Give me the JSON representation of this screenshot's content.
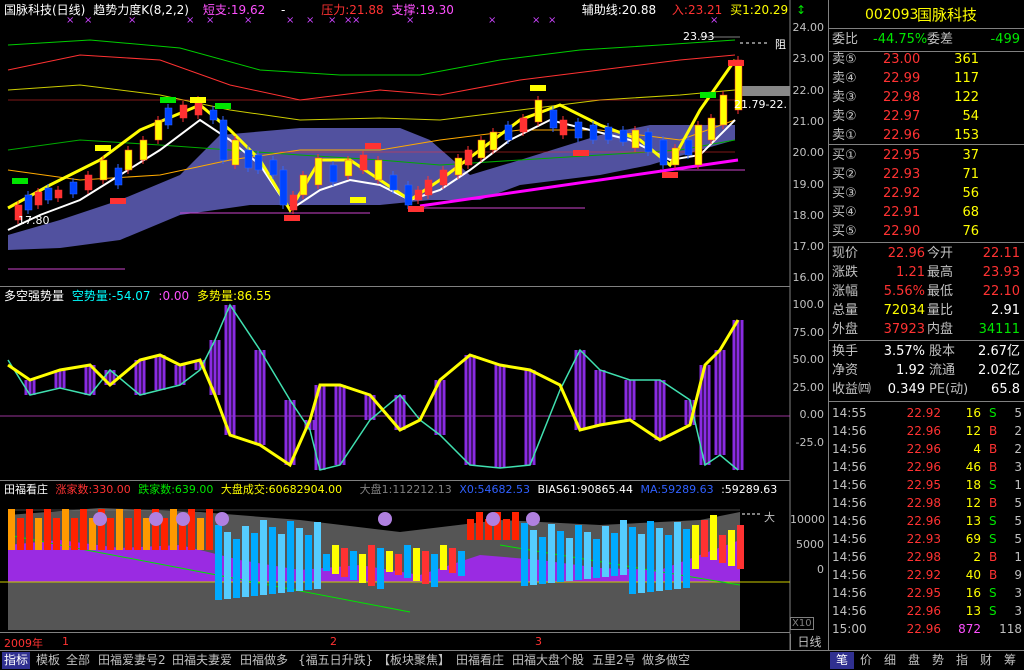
{
  "main_header": {
    "name": "国脉科技(日线)",
    "indicator": "趋势力度K(8,2,2)",
    "short_support": "短支:19.62",
    "dash": "-",
    "pressure": "压力:21.88",
    "support": "支撑:19.30",
    "aux_line": "辅助线:20.88",
    "entry": "入:23.21",
    "buy1": "买1:20.29",
    "arrow": "↕"
  },
  "main_annotations": {
    "peak": "23.93",
    "right_tag": "阻",
    "right_value": "21.79-22.",
    "left_value": "17.80"
  },
  "main_axis": [
    "24.00",
    "23.00",
    "22.00",
    "21.00",
    "20.00",
    "19.00",
    "18.00",
    "17.00",
    "16.00"
  ],
  "mid_header": {
    "title": "多空强势量",
    "empty": "空势量:-54.07",
    "zero": ":0.00",
    "long": "多势量:86.55"
  },
  "mid_axis": [
    "100.0",
    "75.00",
    "50.00",
    "25.00",
    "0.00",
    "-25.0"
  ],
  "low_header": {
    "title": "田福看庄",
    "up_count": "涨家数:330.00",
    "down_count": "跌家数:639.00",
    "market_vol": "大盘成交:60682904.00",
    "market1": "大盘1:112212.13",
    "x": "X0:54682.53",
    "bias": "BIAS61:90865.44",
    "ma": "MA:59289.63",
    "last": ":59289.63"
  },
  "low_axis": [
    "10000",
    "5000",
    "0"
  ],
  "low_annotation": "大",
  "date_bar": {
    "year": "2009年",
    "m1": "1",
    "m2": "2",
    "m3": "3",
    "scale": "X10"
  },
  "stock": {
    "code": "002093",
    "name": "国脉科技"
  },
  "order_book": {
    "webi_label": "委比",
    "webi": "-44.75%",
    "weicha_label": "委差",
    "weicha": "-499",
    "sells": [
      {
        "label": "卖⑤",
        "price": "23.00",
        "vol": "361"
      },
      {
        "label": "卖④",
        "price": "22.99",
        "vol": "117"
      },
      {
        "label": "卖③",
        "price": "22.98",
        "vol": "122"
      },
      {
        "label": "卖②",
        "price": "22.97",
        "vol": "54"
      },
      {
        "label": "卖①",
        "price": "22.96",
        "vol": "153"
      }
    ],
    "buys": [
      {
        "label": "买①",
        "price": "22.95",
        "vol": "37"
      },
      {
        "label": "买②",
        "price": "22.93",
        "vol": "71"
      },
      {
        "label": "买③",
        "price": "22.92",
        "vol": "56"
      },
      {
        "label": "买④",
        "price": "22.91",
        "vol": "68"
      },
      {
        "label": "买⑤",
        "price": "22.90",
        "vol": "76"
      }
    ]
  },
  "quote": [
    {
      "l1": "现价",
      "v1": "22.96",
      "c1": "red",
      "l2": "今开",
      "v2": "22.11",
      "c2": "red"
    },
    {
      "l1": "涨跌",
      "v1": "1.21",
      "c1": "red",
      "l2": "最高",
      "v2": "23.93",
      "c2": "red"
    },
    {
      "l1": "涨幅",
      "v1": "5.56%",
      "c1": "red",
      "l2": "最低",
      "v2": "22.10",
      "c2": "red"
    },
    {
      "l1": "总量",
      "v1": "72034",
      "c1": "yellow",
      "l2": "量比",
      "v2": "2.91",
      "c2": "white"
    },
    {
      "l1": "外盘",
      "v1": "37923",
      "c1": "red",
      "l2": "内盘",
      "v2": "34111",
      "c2": "green"
    }
  ],
  "fundamentals": [
    {
      "l1": "换手",
      "v1": "3.57%",
      "l2": "股本",
      "v2": "2.67亿"
    },
    {
      "l1": "净资",
      "v1": "1.92",
      "l2": "流通",
      "v2": "2.02亿"
    },
    {
      "l1": "收益㈣",
      "v1": "0.349",
      "l2": "PE(动)",
      "v2": "65.8"
    }
  ],
  "ticks": [
    {
      "t": "14:55",
      "p": "22.92",
      "q": "16",
      "f": "S",
      "n": "5"
    },
    {
      "t": "14:56",
      "p": "22.96",
      "q": "12",
      "f": "B",
      "n": "2"
    },
    {
      "t": "14:56",
      "p": "22.96",
      "q": "4",
      "f": "B",
      "n": "2"
    },
    {
      "t": "14:56",
      "p": "22.96",
      "q": "46",
      "f": "B",
      "n": "3"
    },
    {
      "t": "14:56",
      "p": "22.95",
      "q": "18",
      "f": "S",
      "n": "1"
    },
    {
      "t": "14:56",
      "p": "22.98",
      "q": "12",
      "f": "B",
      "n": "5"
    },
    {
      "t": "14:56",
      "p": "22.96",
      "q": "13",
      "f": "S",
      "n": "5"
    },
    {
      "t": "14:56",
      "p": "22.93",
      "q": "69",
      "f": "S",
      "n": "5"
    },
    {
      "t": "14:56",
      "p": "22.98",
      "q": "2",
      "f": "B",
      "n": "1"
    },
    {
      "t": "14:56",
      "p": "22.92",
      "q": "40",
      "f": "B",
      "n": "9"
    },
    {
      "t": "14:56",
      "p": "22.95",
      "q": "16",
      "f": "S",
      "n": "3"
    },
    {
      "t": "14:56",
      "p": "22.96",
      "q": "13",
      "f": "S",
      "n": "3"
    },
    {
      "t": "15:00",
      "p": "22.96",
      "q": "872",
      "f": "",
      "n": "118"
    }
  ],
  "tabs": [
    "指标",
    "模板",
    "全部",
    "田福爱妻号2",
    "田福夫妻爱",
    "田福做多",
    "{福五日升跌}",
    "【板块聚焦】",
    "田福看庄",
    "田福大盘个股",
    "五里2号",
    "做多做空"
  ],
  "right_tabs": [
    "笔",
    "价",
    "细",
    "盘",
    "势",
    "指",
    "财",
    "筹"
  ],
  "period": "日线",
  "colors": {
    "up": "#ff3232",
    "down": "#00e600",
    "accent": "#ffff00",
    "band": "#6666bb"
  }
}
